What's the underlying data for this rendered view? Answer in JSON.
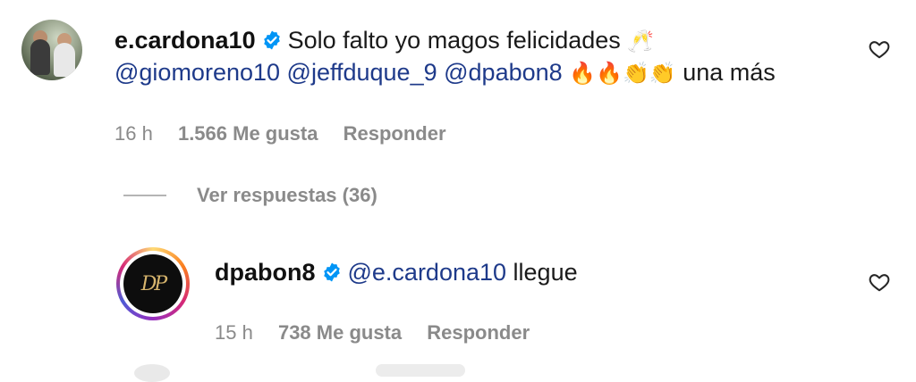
{
  "comments": [
    {
      "username": "e.cardona10",
      "line1_text": "Solo falto yo magos felicidades",
      "line1_emoji": "🥂",
      "mentions": [
        "@giomoreno10",
        "@jeffduque_9",
        "@dpabon8"
      ],
      "line2_emoji": "🔥🔥👏👏",
      "line2_text": "una más",
      "time": "16 h",
      "likes": "1.566 Me gusta",
      "reply": "Responder",
      "view_replies": "Ver respuestas (36)"
    },
    {
      "username": "dpabon8",
      "mention": "@e.cardona10",
      "text": "llegue",
      "avatar_text": "DP",
      "time": "15 h",
      "likes": "738 Me gusta",
      "reply": "Responder"
    }
  ],
  "icons": {
    "verified": "verified-badge-icon",
    "like": "heart-outline-icon"
  },
  "colors": {
    "verified": "#0095f6",
    "mention": "#1e3a8a",
    "meta": "#8a8a8a"
  }
}
